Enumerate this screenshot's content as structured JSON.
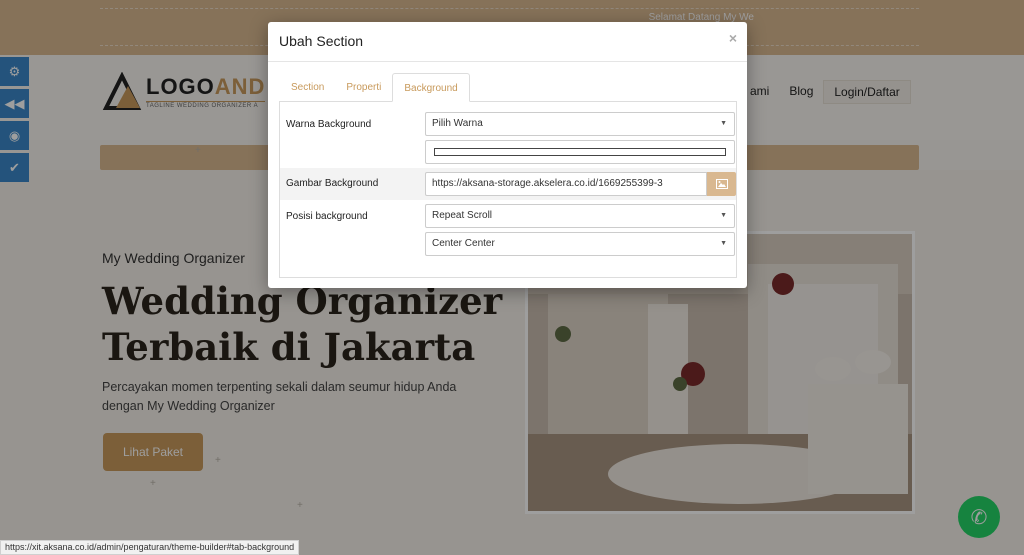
{
  "site": {
    "welcome": "Selamat Datang My We",
    "logo_name_a": "LOGO",
    "logo_name_b": "AND",
    "logo_tagline": "TAGLINE WEDDING ORGANIZER A",
    "nav": [
      "ami",
      "Blog",
      "Login/Daftar"
    ],
    "hero_sub": "My Wedding Organizer",
    "hero_title": "Wedding Organizer Terbaik di Jakarta",
    "hero_desc": "Percayakan momen terpenting sekali dalam seumur hidup Anda dengan My Wedding Organizer",
    "hero_button": "Lihat Paket",
    "status_url": "https://xit.aksana.co.id/admin/pengaturan/theme-builder#tab-background"
  },
  "sidetools": [
    "gears-icon",
    "rewind-icon",
    "eye-icon",
    "check-icon"
  ],
  "modal": {
    "title": "Ubah Section",
    "close": "×",
    "tabs": [
      {
        "label": "Section",
        "active": false
      },
      {
        "label": "Properti",
        "active": false
      },
      {
        "label": "Background",
        "active": true
      }
    ],
    "warna_label": "Warna Background",
    "warna_value": "Pilih Warna",
    "gambar_label": "Gambar Background",
    "gambar_value": "https://aksana-storage.akselera.co.id/1669255399-3",
    "posisi_label": "Posisi background",
    "posisi_repeat": "Repeat Scroll",
    "posisi_align": "Center Center"
  },
  "colors": {
    "accent": "#c89a5c",
    "tool_blue": "#3a87c8",
    "whatsapp": "#25d366"
  }
}
